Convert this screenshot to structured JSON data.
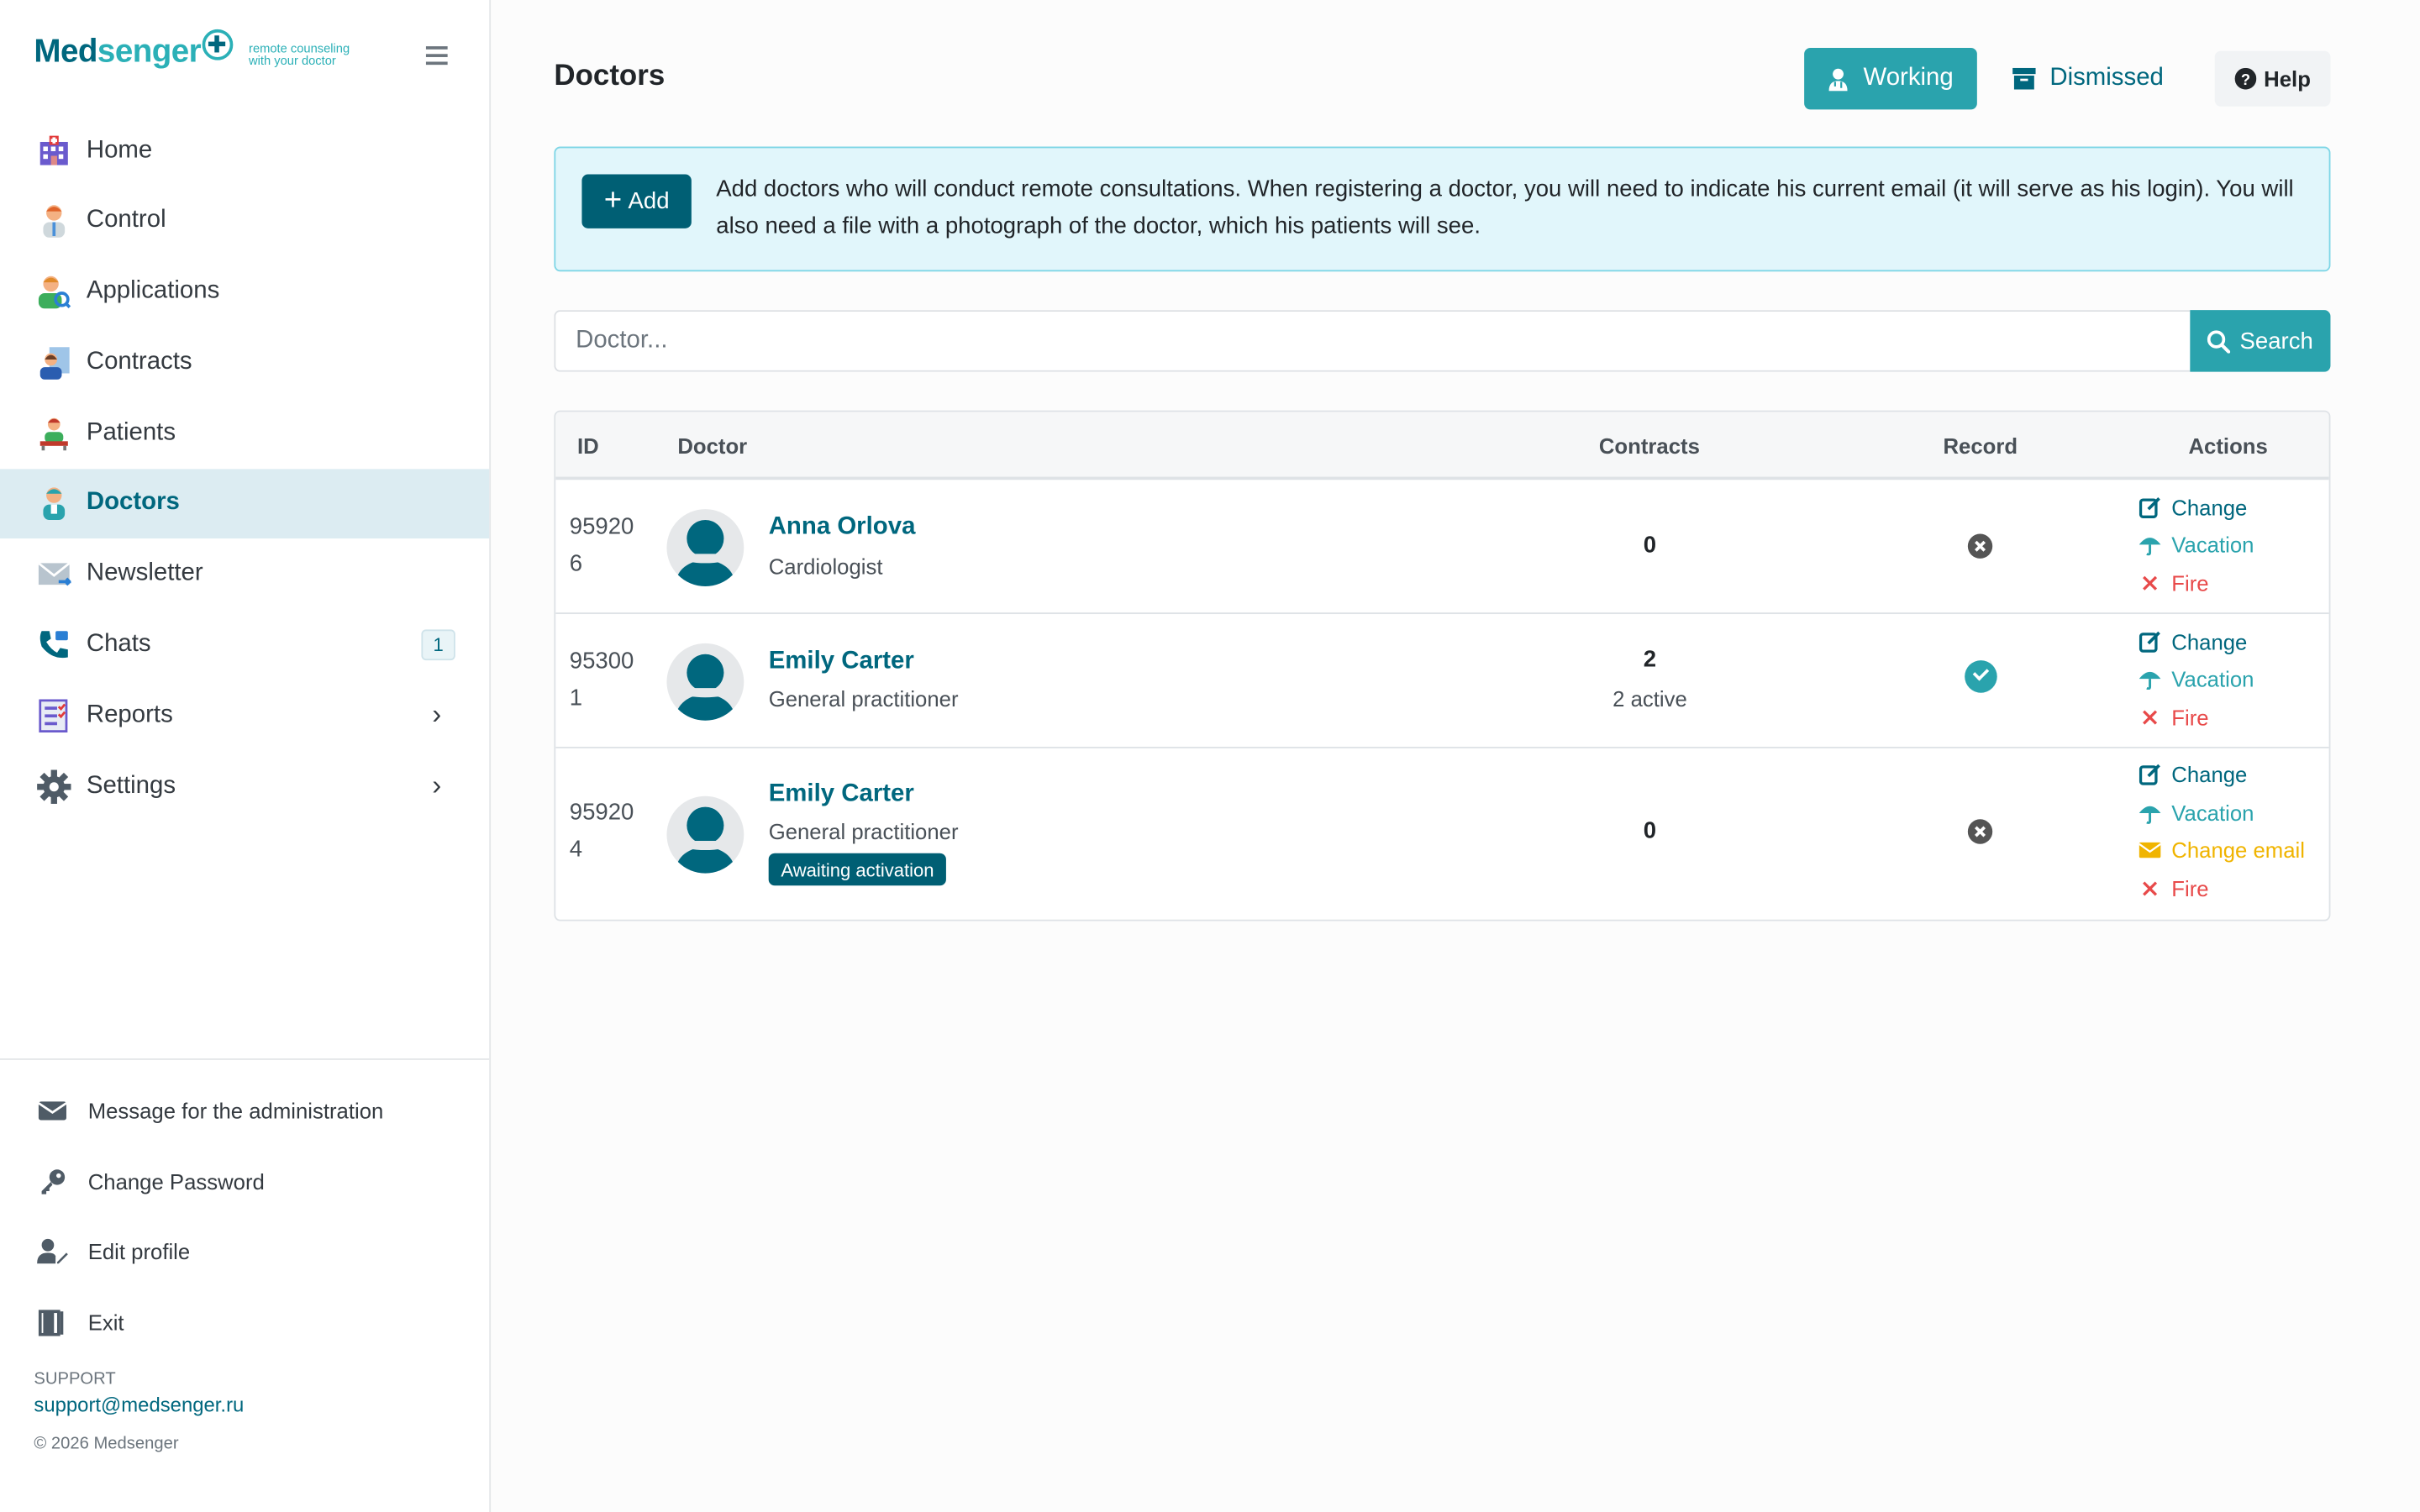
{
  "brand": {
    "name_part1": "Med",
    "name_part2": "senger",
    "tagline_line1": "remote counseling",
    "tagline_line2": "with your doctor"
  },
  "sidebar": {
    "items": [
      {
        "label": "Home",
        "icon": "home-icon"
      },
      {
        "label": "Control",
        "icon": "control-icon"
      },
      {
        "label": "Applications",
        "icon": "applications-icon"
      },
      {
        "label": "Contracts",
        "icon": "contracts-icon"
      },
      {
        "label": "Patients",
        "icon": "patients-icon"
      },
      {
        "label": "Doctors",
        "icon": "doctor-icon",
        "active": true
      },
      {
        "label": "Newsletter",
        "icon": "mail-icon"
      },
      {
        "label": "Chats",
        "icon": "phone-icon",
        "badge": "1"
      },
      {
        "label": "Reports",
        "icon": "reports-icon",
        "chevron": true
      },
      {
        "label": "Settings",
        "icon": "gear-icon",
        "chevron": true
      }
    ],
    "bottom": [
      {
        "label": "Message for the administration",
        "icon": "envelope-icon"
      },
      {
        "label": "Change Password",
        "icon": "key-icon"
      },
      {
        "label": "Edit profile",
        "icon": "user-edit-icon"
      },
      {
        "label": "Exit",
        "icon": "exit-icon"
      }
    ],
    "support_label": "SUPPORT",
    "support_email": "support@medsenger.ru",
    "copyright": "© 2026 Medsenger"
  },
  "header": {
    "title": "Doctors",
    "working_label": "Working",
    "dismissed_label": "Dismissed",
    "help_label": "Help"
  },
  "info": {
    "add_label": "Add",
    "text": "Add doctors who will conduct remote consultations. When registering a doctor, you will need to indicate his current email (it will serve as his login). You will also need a file with a photograph of the doctor, which his patients will see."
  },
  "search": {
    "placeholder": "Doctor...",
    "button_label": "Search"
  },
  "table": {
    "columns": [
      "ID",
      "Doctor",
      "Contracts",
      "Record",
      "Actions"
    ],
    "rows": [
      {
        "id_line1": "95920",
        "id_line2": "6",
        "name": "Anna Orlova",
        "specialty": "Cardiologist",
        "contracts": "0",
        "contracts_active": "",
        "record": "no",
        "badge": "",
        "actions": [
          "Change",
          "Vacation",
          "Fire"
        ]
      },
      {
        "id_line1": "95300",
        "id_line2": "1",
        "name": "Emily Carter",
        "specialty": "General practitioner",
        "contracts": "2",
        "contracts_active": "2 active",
        "record": "yes",
        "badge": "",
        "actions": [
          "Change",
          "Vacation",
          "Fire"
        ]
      },
      {
        "id_line1": "95920",
        "id_line2": "4",
        "name": "Emily Carter",
        "specialty": "General practitioner",
        "contracts": "0",
        "contracts_active": "",
        "record": "no",
        "badge": "Awaiting activation",
        "actions": [
          "Change",
          "Vacation",
          "Change email",
          "Fire"
        ]
      }
    ]
  },
  "colors": {
    "brand_dark": "#00677e",
    "brand_teal": "#2aa3ad",
    "fire": "#e84a4a",
    "warning": "#f0b400",
    "active_bg": "#dcecf2"
  }
}
